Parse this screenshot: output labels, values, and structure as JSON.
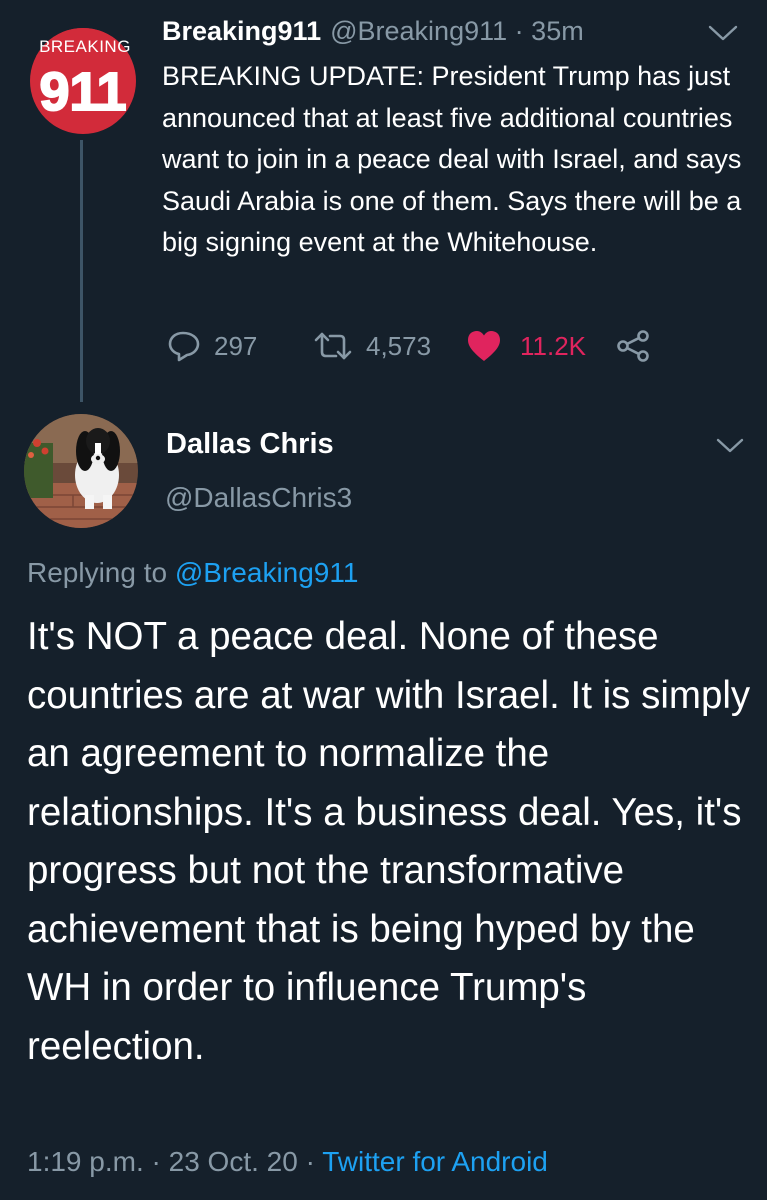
{
  "tweet1": {
    "avatar_logo_top": "BREAKING",
    "avatar_logo_number": "911",
    "display_name": "Breaking911",
    "handle": "@Breaking911",
    "separator": "·",
    "time": "35m",
    "text": "BREAKING UPDATE: President Trump has just announced that at least five additional countries want to join in a peace deal with Israel, and says Saudi Arabia is one of them. Says there will be a big signing event at the Whitehouse.",
    "actions": {
      "reply_count": "297",
      "retweet_count": "4,573",
      "like_count": "11.2K"
    },
    "icons": {
      "reply": "reply-icon",
      "retweet": "retweet-icon",
      "like": "heart-icon",
      "share": "share-icon",
      "menu": "chevron-down-icon"
    },
    "colors": {
      "brand_red": "#d22b3a",
      "like": "#e0245e"
    }
  },
  "tweet2": {
    "display_name": "Dallas Chris",
    "handle": "@DallasChris3",
    "replying_prefix": "Replying to",
    "replying_to": "@Breaking911",
    "text": "It's NOT a peace deal. None of these countries are at war with Israel. It is simply an agreement to normalize the relationships. It's a business deal. Yes, it's progress but not the transformative achievement that is being hyped by the WH in order to influence Trump's reelection.",
    "time": "1:19 p.m.",
    "separator1": "·",
    "date": "23 Oct. 20",
    "separator2": "·",
    "source": "Twitter for Android"
  },
  "theme": {
    "background": "#15202b",
    "text": "#ffffff",
    "secondary_text": "#8899a6",
    "link": "#1da1f2"
  }
}
